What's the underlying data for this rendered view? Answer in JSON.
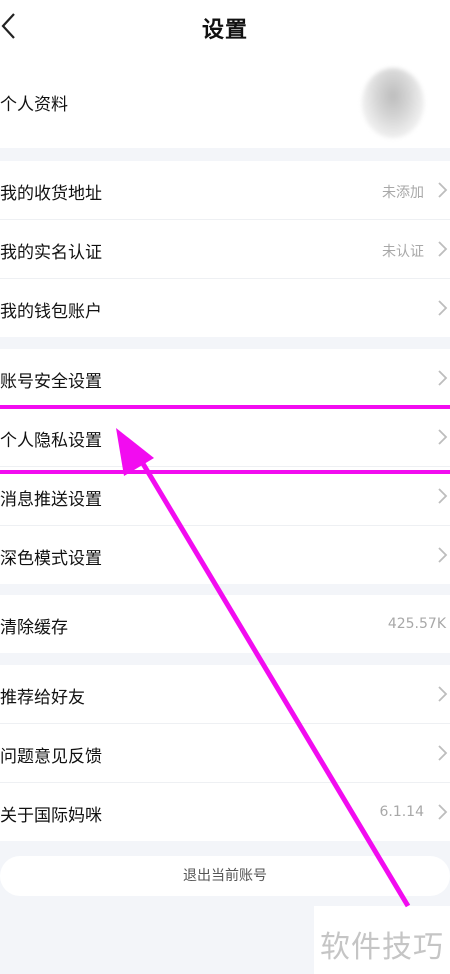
{
  "header": {
    "title": "设置"
  },
  "profile": {
    "label": "个人资料"
  },
  "groups": [
    {
      "rows": [
        {
          "label": "我的收货地址",
          "value": "未添加"
        },
        {
          "label": "我的实名认证",
          "value": "未认证"
        },
        {
          "label": "我的钱包账户",
          "value": ""
        }
      ]
    },
    {
      "rows": [
        {
          "label": "账号安全设置"
        },
        {
          "label": "个人隐私设置"
        },
        {
          "label": "消息推送设置"
        },
        {
          "label": "深色模式设置"
        }
      ]
    },
    {
      "rows": [
        {
          "label": "清除缓存",
          "value": "425.57K"
        }
      ]
    },
    {
      "rows": [
        {
          "label": "推荐给好友"
        },
        {
          "label": "问题意见反馈"
        },
        {
          "label": "关于国际妈咪",
          "value": "6.1.14"
        }
      ]
    }
  ],
  "logout": {
    "label": "退出当前账号"
  },
  "watermark": {
    "text": "软件技巧"
  },
  "colors": {
    "annotation": "#f20cf0",
    "value_text": "#a8a8a8",
    "divider": "#f3f5f9"
  }
}
